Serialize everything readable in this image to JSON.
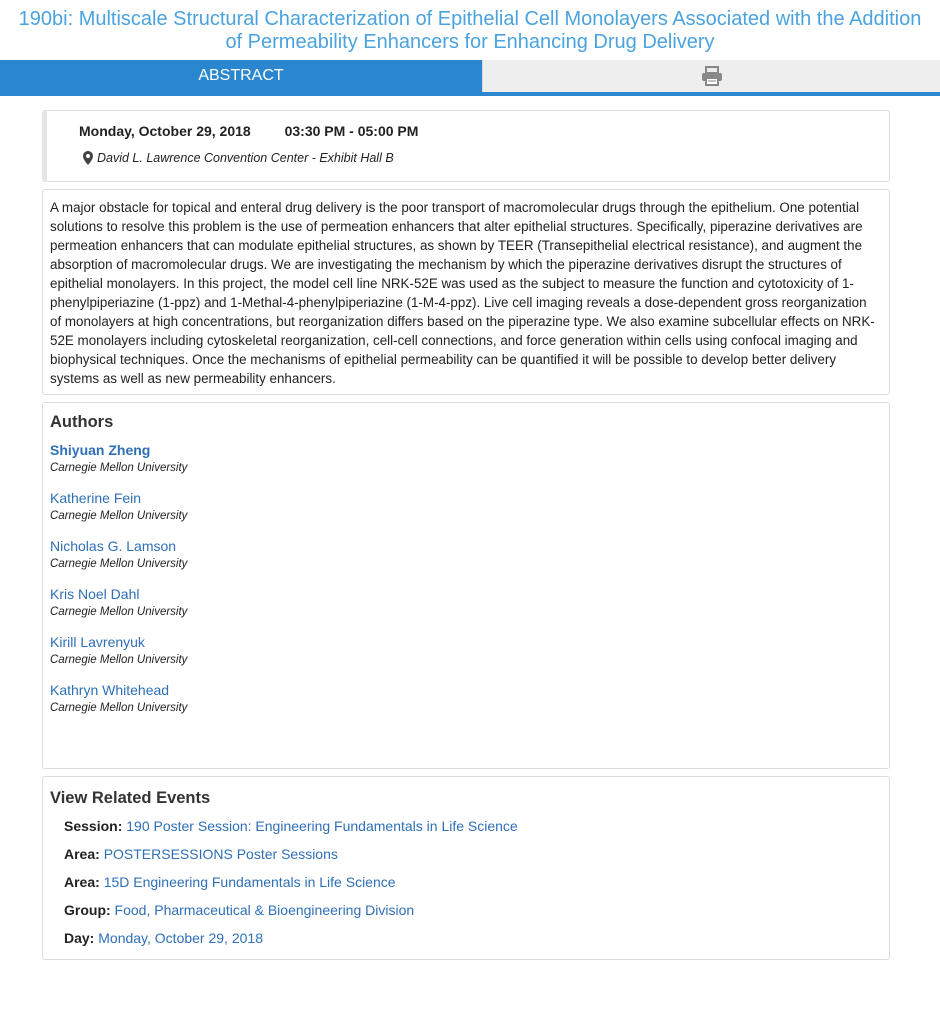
{
  "title": "190bi: Multiscale Structural Characterization of Epithelial Cell Monolayers Associated with the Addition of Permeability Enhancers for Enhancing Drug Delivery",
  "tabs": {
    "abstract_label": "ABSTRACT",
    "print_icon": "printer-icon"
  },
  "session": {
    "date": "Monday, October 29, 2018",
    "time": "03:30 PM - 05:00 PM",
    "location_icon": "map-marker-icon",
    "location": "David L. Lawrence Convention Center - Exhibit Hall B"
  },
  "abstract": "A major obstacle for topical and enteral drug delivery is the poor transport of macromolecular drugs through the epithelium. One potential solutions to resolve this problem is the use of permeation enhancers that alter epithelial structures. Specifically, piperazine derivatives are permeation enhancers that can modulate epithelial structures, as shown by TEER (Transepithelial electrical resistance), and augment the absorption of macromolecular drugs. We are investigating the mechanism by which the piperazine derivatives disrupt the structures of epithelial monolayers. In this project, the model cell line NRK-52E was used as the subject to measure the function and cytotoxicity of 1-phenylpiperiazine (1-ppz) and 1-Methal-4-phenylpiperiazine (1-M-4-ppz). Live cell imaging reveals a dose-dependent gross reorganization of monolayers at high concentrations, but reorganization differs based on the piperazine type. We also examine subcellular effects on NRK-52E monolayers including cytoskeletal reorganization, cell-cell connections, and force generation within cells using confocal imaging and biophysical techniques. Once the mechanisms of epithelial permeability can be quantified it will be possible to develop better delivery systems as well as new permeability enhancers.",
  "authors": {
    "heading": "Authors",
    "items": [
      {
        "name": "Shiyuan Zheng",
        "affiliation": "Carnegie Mellon University",
        "presenter": true
      },
      {
        "name": "Katherine Fein",
        "affiliation": "Carnegie Mellon University",
        "presenter": false
      },
      {
        "name": "Nicholas G. Lamson",
        "affiliation": "Carnegie Mellon University",
        "presenter": false
      },
      {
        "name": "Kris Noel Dahl",
        "affiliation": "Carnegie Mellon University",
        "presenter": false
      },
      {
        "name": "Kirill Lavrenyuk",
        "affiliation": "Carnegie Mellon University",
        "presenter": false
      },
      {
        "name": "Kathryn Whitehead",
        "affiliation": "Carnegie Mellon University",
        "presenter": false
      }
    ]
  },
  "related": {
    "heading": "View Related Events",
    "items": [
      {
        "label": "Session:",
        "value": "190 Poster Session: Engineering Fundamentals in Life Science"
      },
      {
        "label": "Area:",
        "value": "POSTERSESSIONS Poster Sessions"
      },
      {
        "label": "Area:",
        "value": "15D Engineering Fundamentals in Life Science"
      },
      {
        "label": "Group:",
        "value": "Food, Pharmaceutical & Bioengineering Division"
      },
      {
        "label": "Day:",
        "value": "Monday, October 29, 2018"
      }
    ]
  },
  "colors": {
    "title": "#4aa3df",
    "tab_active": "#2a87cf",
    "link": "#2f6fb7"
  }
}
